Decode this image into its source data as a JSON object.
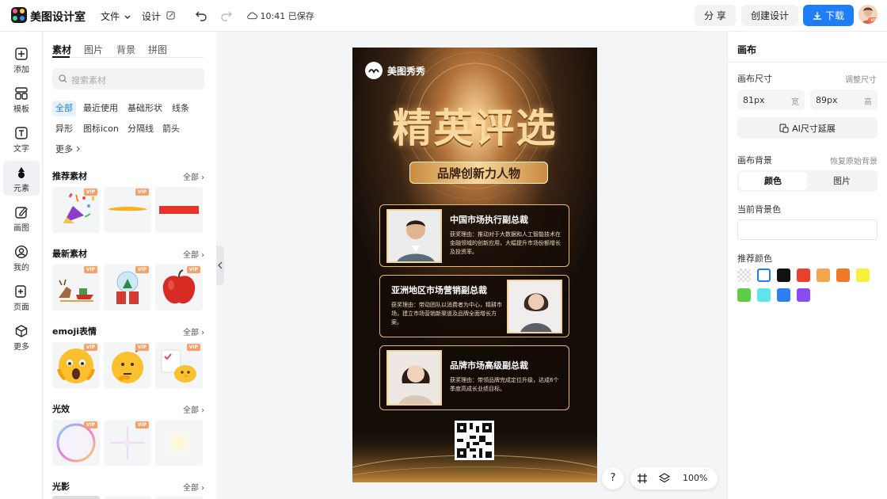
{
  "topbar": {
    "app_name": "美图设计室",
    "menu_file": "文件",
    "menu_design": "设计",
    "saved_status": "10:41 已保存",
    "share_label": "分 享",
    "create_label": "创建设计",
    "download_label": "下载"
  },
  "rail": {
    "items": [
      {
        "label": "添加",
        "icon": "plus-square-icon"
      },
      {
        "label": "模板",
        "icon": "template-icon"
      },
      {
        "label": "文字",
        "icon": "text-icon"
      },
      {
        "label": "元素",
        "icon": "shapes-icon"
      },
      {
        "label": "画图",
        "icon": "draw-icon"
      },
      {
        "label": "我的",
        "icon": "user-icon"
      },
      {
        "label": "页面",
        "icon": "page-add-icon"
      },
      {
        "label": "更多",
        "icon": "cube-icon"
      }
    ]
  },
  "panel": {
    "tabs": [
      "素材",
      "图片",
      "背景",
      "拼图"
    ],
    "search_placeholder": "搜索素材",
    "chips": [
      "全部",
      "最近使用",
      "基础形状",
      "线条",
      "异形",
      "图标icon",
      "分隔线",
      "箭头",
      "更多"
    ],
    "sections": [
      {
        "title": "推荐素材",
        "all": "全部"
      },
      {
        "title": "最新素材",
        "all": "全部"
      },
      {
        "title": "emoji表情",
        "all": "全部"
      },
      {
        "title": "光效",
        "all": "全部"
      },
      {
        "title": "光影",
        "all": "全部"
      }
    ],
    "vip_badge": "VIP"
  },
  "poster": {
    "brand": "美图秀秀",
    "title": "精英评选",
    "subtitle": "品牌创新力人物",
    "cards": [
      {
        "title": "中国市场执行副总裁",
        "text": "获奖理由：推动对于大数据和人工智能技术在金融领域的创新应用，大幅提升市场份额增长及投资率。"
      },
      {
        "title": "亚洲地区市场营销副总裁",
        "text": "获奖理由：带动团队以消费者为中心，精耕市场，建立市场营销新渠道及品牌全面增长方案。"
      },
      {
        "title": "品牌市场高级副总裁",
        "text": "获奖理由：带领品牌完成定位升级，达成6个季度高成长业绩目标。"
      }
    ]
  },
  "floatbar": {
    "help": "?",
    "zoom": "100%"
  },
  "props": {
    "title": "画布",
    "size_label": "画布尺寸",
    "size_adjust": "调整尺寸",
    "width_value": "81px",
    "width_unit": "宽",
    "height_value": "89px",
    "height_unit": "高",
    "ai_extend": "AI尺寸延展",
    "bg_label": "画布背景",
    "bg_reset": "恢复原始背景",
    "seg_color": "颜色",
    "seg_image": "图片",
    "current_bg": "当前背景色",
    "recommended": "推荐颜色",
    "swatches": [
      "transparent",
      "#ffffff",
      "#111111",
      "#e8412c",
      "#f5a54a",
      "#f07a2a",
      "#f7f13c",
      "#5dcc47",
      "#5ee6ef",
      "#2d7ff0",
      "#8a4cf0"
    ]
  }
}
